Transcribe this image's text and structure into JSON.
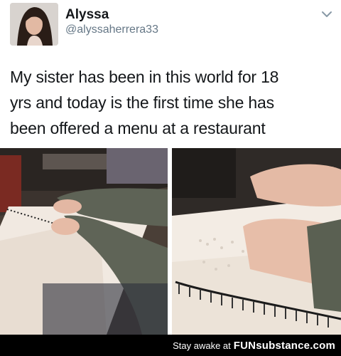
{
  "tweet": {
    "display_name": "Alyssa",
    "handle": "@alyssaherrera33",
    "text_lines": [
      "My sister has been in this world for 18",
      "yrs and today is the first time she has",
      "been offered a menu at a restaurant"
    ]
  },
  "icons": {
    "menu_chevron": "chevron-down-icon"
  },
  "photos": [
    {
      "name": "braille-menu-photo-left",
      "description_shown": false
    },
    {
      "name": "braille-menu-photo-right",
      "description_shown": false
    }
  ],
  "footer": {
    "prefix": "Stay awake at",
    "brand_fun": "FUN",
    "brand_sub": "substance",
    "brand_domain": ".com"
  },
  "colors": {
    "text": "#14171a",
    "handle": "#657786",
    "footer_bg": "#000000"
  }
}
